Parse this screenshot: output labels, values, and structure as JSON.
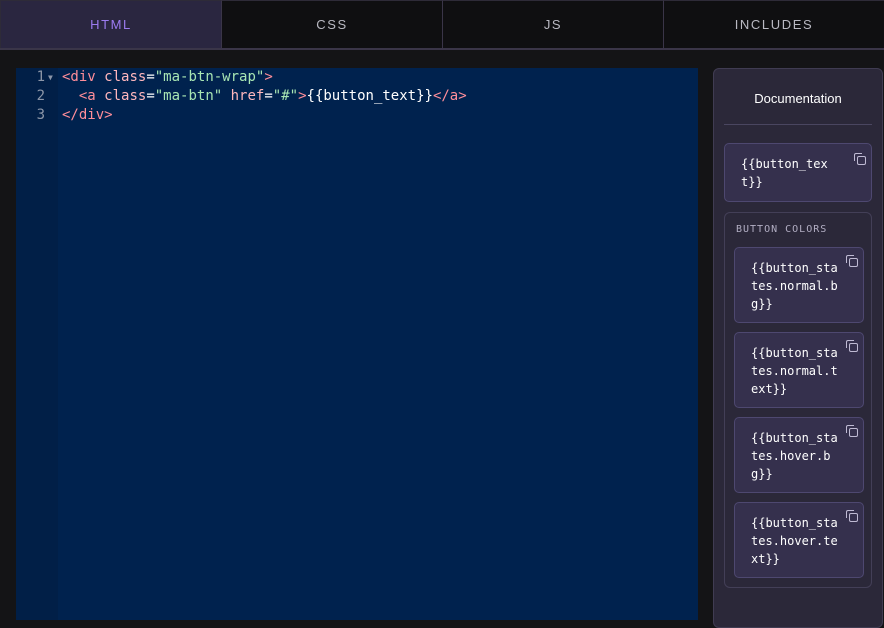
{
  "tabs": [
    {
      "label": "HTML",
      "active": true
    },
    {
      "label": "CSS",
      "active": false
    },
    {
      "label": "JS",
      "active": false
    },
    {
      "label": "INCLUDES",
      "active": false
    }
  ],
  "editor": {
    "lines": [
      {
        "number": "1",
        "tokens": [
          {
            "text": "<div ",
            "type": "tag"
          },
          {
            "text": "class",
            "type": "attr"
          },
          {
            "text": "=",
            "type": "txt"
          },
          {
            "text": "\"ma-btn-wrap\"",
            "type": "val"
          },
          {
            "text": ">",
            "type": "tag"
          }
        ]
      },
      {
        "number": "2",
        "tokens": [
          {
            "text": "  <a ",
            "type": "tag"
          },
          {
            "text": "class",
            "type": "attr"
          },
          {
            "text": "=",
            "type": "txt"
          },
          {
            "text": "\"ma-btn\"",
            "type": "val"
          },
          {
            "text": " href",
            "type": "attr"
          },
          {
            "text": "=",
            "type": "txt"
          },
          {
            "text": "\"#\"",
            "type": "val"
          },
          {
            "text": ">",
            "type": "tag"
          },
          {
            "text": "{{button_text}}",
            "type": "txt"
          },
          {
            "text": "</a>",
            "type": "tag"
          }
        ]
      },
      {
        "number": "3",
        "tokens": [
          {
            "text": "</div>",
            "type": "tag"
          }
        ]
      }
    ]
  },
  "docs": {
    "title": "Documentation",
    "top_variable": "{{button_text}}",
    "group": {
      "title": "BUTTON COLORS",
      "variables": [
        "{{button_states.normal.bg}}",
        "{{button_states.normal.text}}",
        "{{button_states.hover.bg}}",
        "{{button_states.hover.text}}"
      ]
    },
    "copy_icon": "copy-icon"
  },
  "colors": {
    "accent": "#9c7bf0",
    "editor_bg": "#00224e",
    "panel_bg": "#2b2839"
  }
}
